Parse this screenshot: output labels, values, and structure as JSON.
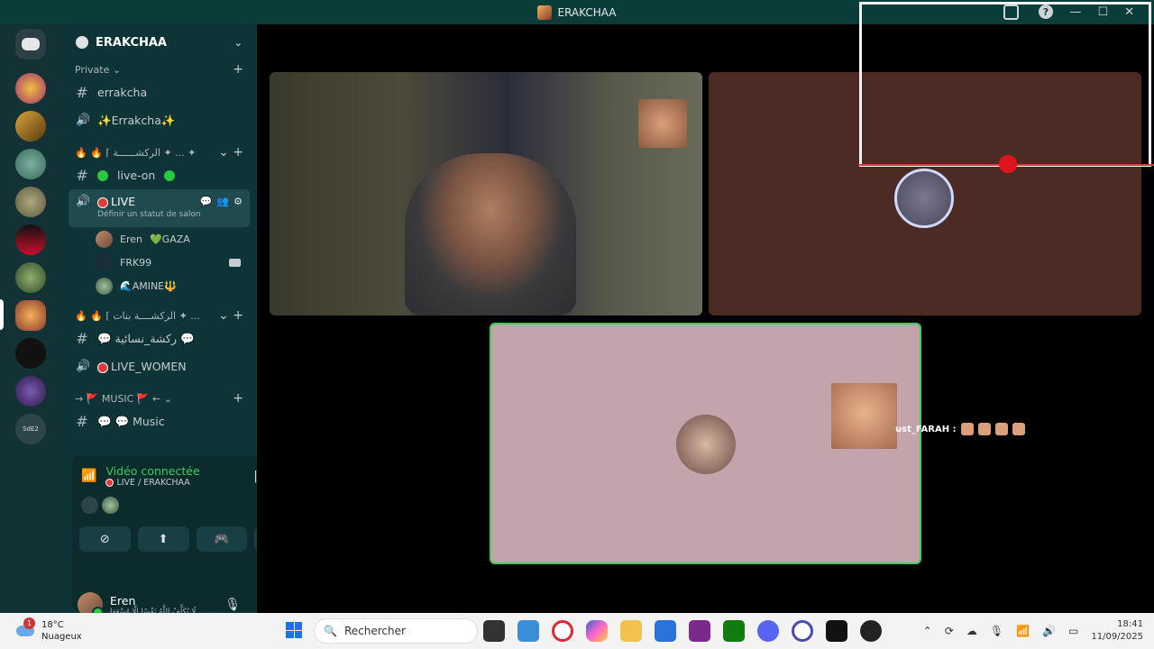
{
  "window": {
    "title": "ERAKCHAA"
  },
  "server": {
    "name": "ERAKCHAA"
  },
  "sidebar": {
    "category_private": "Private",
    "channels_private": [
      {
        "label": "errakcha",
        "kind": "text"
      },
      {
        "label": "✨Errakcha✨",
        "kind": "voice"
      }
    ],
    "category_2": "🔥 🔥 ⌈ الركشــــــة ✦ ... ✦",
    "channels_2": [
      {
        "label": "live-on",
        "kind": "text"
      }
    ],
    "active_channel": {
      "label": "LIVE",
      "status_placeholder": "Définir un statut de salon"
    },
    "members": [
      {
        "name": "Eren",
        "extra": "💚GAZA"
      },
      {
        "name": "FRK99",
        "extra": ""
      },
      {
        "name": "🌊AMINE🔱",
        "extra": ""
      }
    ],
    "category_3": "🔥 🔥 ⌈ الركشــــة بنات ✦ ...",
    "channels_3": [
      {
        "label": "💬 ركشة_نسائية 💬",
        "kind": "text"
      },
      {
        "label": "LIVE_WOMEN",
        "kind": "voice"
      }
    ],
    "category_4": "→ 🚩 MUSIC 🚩 ←",
    "channels_4": [
      {
        "label": "💬 💬 Music",
        "kind": "text"
      }
    ]
  },
  "voice_panel": {
    "status": "Vidéo connectée",
    "channel": "LIVE / ERAKCHAA"
  },
  "user": {
    "name": "Eren",
    "status": "لَا يُكَلِّفُ اللَّهُ نَفْسًا إِلَّا وُسْعَهَا"
  },
  "stage": {
    "overlay_text": "ust_FARAH :"
  },
  "taskbar": {
    "temperature": "18°C",
    "weather": "Nuageux",
    "weather_badge": "1",
    "search_placeholder": "Rechercher",
    "time": "18:41",
    "date": "11/09/2025"
  },
  "colors": {
    "accent_green": "#3bd05a",
    "sidebar_bg": "#0f3437",
    "rail_bg": "#123236",
    "live_red": "#e23a3a"
  }
}
